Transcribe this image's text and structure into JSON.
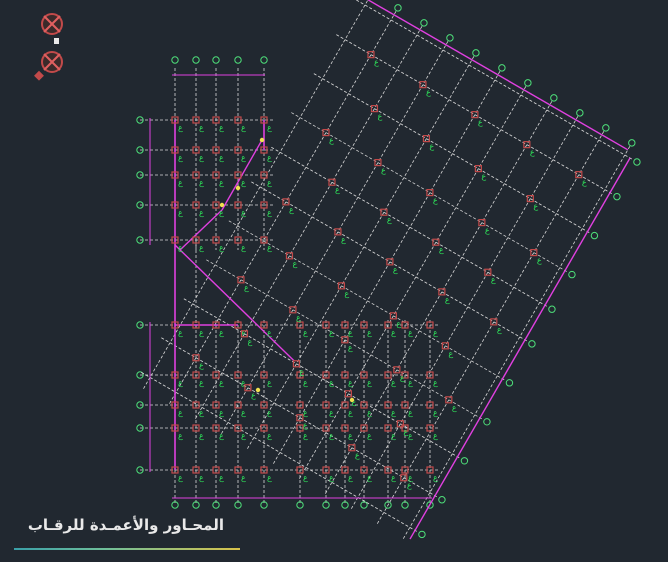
{
  "app": {
    "name": "CAD drawing viewport"
  },
  "title": "المحـاور والأعمـدة للرقـاب",
  "colors": {
    "background": "#212830",
    "grid": "#d9d9d9",
    "dim": "#e040e0",
    "label": "#2ee65a",
    "column": "#c24a4a",
    "axis_bubble": "#4ee07a",
    "highlight": "#f0e050"
  },
  "column_label": "ع",
  "icons": [
    "viewcube-icon",
    "compass-icon",
    "pan-icon"
  ]
}
